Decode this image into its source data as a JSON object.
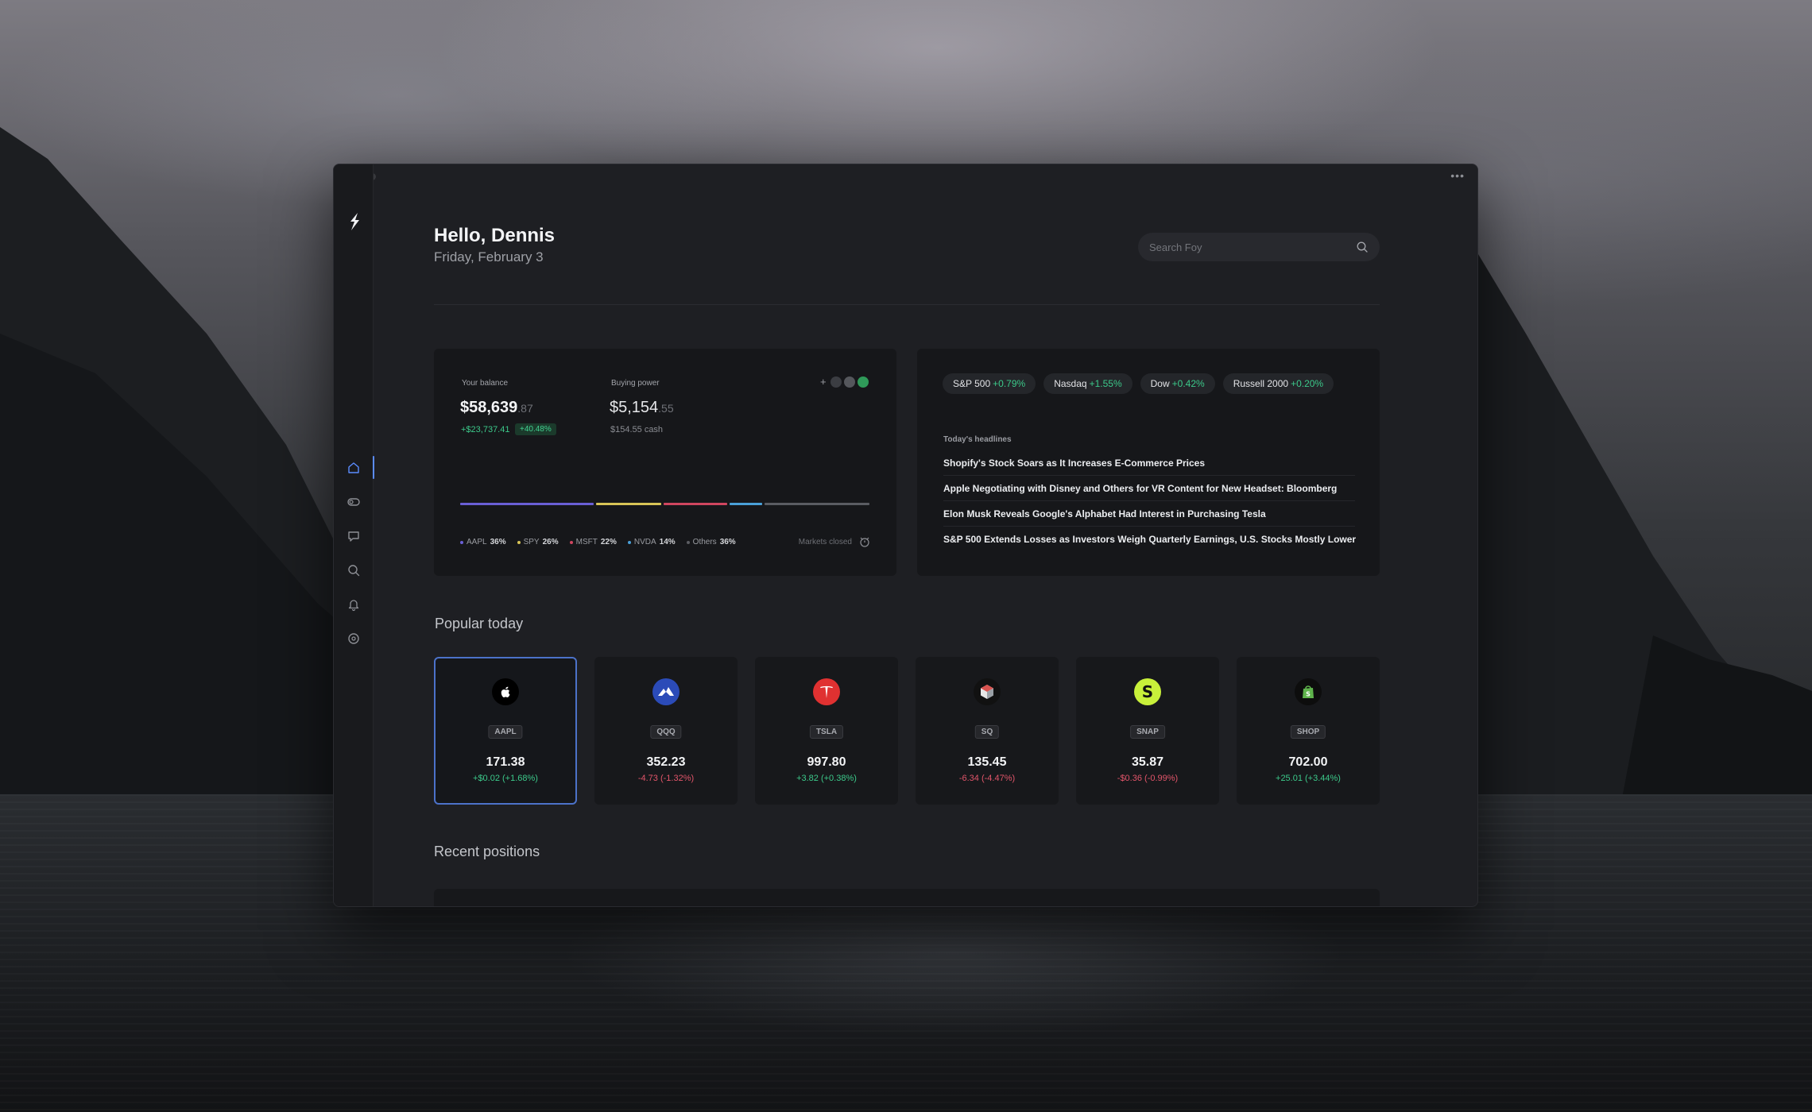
{
  "colors": {
    "accent": "#5b8cff",
    "positive": "#3cc98a",
    "negative": "#e2556a",
    "window_bg": "#1e1f23",
    "card_bg": "#16171a"
  },
  "sidebar": {
    "logo_icon": "flash-logo-icon",
    "items": [
      {
        "name": "home",
        "icon": "home-icon",
        "active": true
      },
      {
        "name": "portfolio",
        "icon": "toggle-icon",
        "active": false
      },
      {
        "name": "messages",
        "icon": "chat-icon",
        "active": false
      },
      {
        "name": "discover",
        "icon": "search-icon",
        "active": false
      },
      {
        "name": "notifications",
        "icon": "bell-icon",
        "active": false
      },
      {
        "name": "settings",
        "icon": "settings-icon",
        "active": false
      }
    ]
  },
  "header": {
    "greeting": "Hello, Dennis",
    "date": "Friday, February 3",
    "search_placeholder": "Search Foy"
  },
  "balance": {
    "label": "Your balance",
    "value_main": "$58,639",
    "value_cents": ".87",
    "gain_value": "+$23,737.41",
    "gain_pct": "+40.48%",
    "buying_power_label": "Buying power",
    "buying_power_main": "$5,154",
    "buying_power_cents": ".55",
    "cash_note": "$154.55 cash",
    "controls_plus": "+",
    "allocation": [
      {
        "ticker": "AAPL",
        "pct": "36%",
        "share": 0.33,
        "color": "#6a5fd6"
      },
      {
        "ticker": "SPY",
        "pct": "26%",
        "share": 0.165,
        "color": "#d8c457"
      },
      {
        "ticker": "MSFT",
        "pct": "22%",
        "share": 0.16,
        "color": "#d0465f"
      },
      {
        "ticker": "NVDA",
        "pct": "14%",
        "share": 0.085,
        "color": "#4aa0d8"
      },
      {
        "ticker": "Others",
        "pct": "36%",
        "share": 0.26,
        "color": "#5a5c62"
      }
    ],
    "market_status": "Markets closed"
  },
  "market": {
    "indices": [
      {
        "name": "S&P 500",
        "change": "+0.79%"
      },
      {
        "name": "Nasdaq",
        "change": "+1.55%"
      },
      {
        "name": "Dow",
        "change": "+0.42%"
      },
      {
        "name": "Russell 2000",
        "change": "+0.20%"
      }
    ],
    "headlines_label": "Today's headlines",
    "headlines": [
      "Shopify's Stock Soars as It Increases E-Commerce Prices",
      "Apple Negotiating with Disney and Others for VR Content for New Headset: Bloomberg",
      "Elon Musk Reveals Google's Alphabet Had Interest in Purchasing Tesla",
      "S&P 500 Extends Losses as Investors Weigh Quarterly Earnings, U.S. Stocks Mostly Lower"
    ]
  },
  "popular": {
    "title": "Popular today",
    "stocks": [
      {
        "ticker": "AAPL",
        "price": "171.38",
        "change": "+$0.02 (+1.68%)",
        "direction": "up",
        "selected": true,
        "logo_bg": "#000000",
        "icon": "apple-logo-icon"
      },
      {
        "ticker": "QQQ",
        "price": "352.23",
        "change": "-4.73 (-1.32%)",
        "direction": "down",
        "selected": false,
        "logo_bg": "#2b4bb8",
        "icon": "invesco-logo-icon"
      },
      {
        "ticker": "TSLA",
        "price": "997.80",
        "change": "+3.82 (+0.38%)",
        "direction": "up",
        "selected": false,
        "logo_bg": "#e03131",
        "icon": "tesla-logo-icon"
      },
      {
        "ticker": "SQ",
        "price": "135.45",
        "change": "-6.34 (-4.47%)",
        "direction": "down",
        "selected": false,
        "logo_bg": "#111111",
        "icon": "block-logo-icon"
      },
      {
        "ticker": "SNAP",
        "price": "35.87",
        "change": "-$0.36 (-0.99%)",
        "direction": "down",
        "selected": false,
        "logo_bg": "#c8f03a",
        "icon": "snap-logo-icon"
      },
      {
        "ticker": "SHOP",
        "price": "702.00",
        "change": "+25.01 (+3.44%)",
        "direction": "up",
        "selected": false,
        "logo_bg": "#0d0d0d",
        "icon": "shopify-logo-icon"
      }
    ]
  },
  "positions": {
    "title": "Recent positions"
  }
}
